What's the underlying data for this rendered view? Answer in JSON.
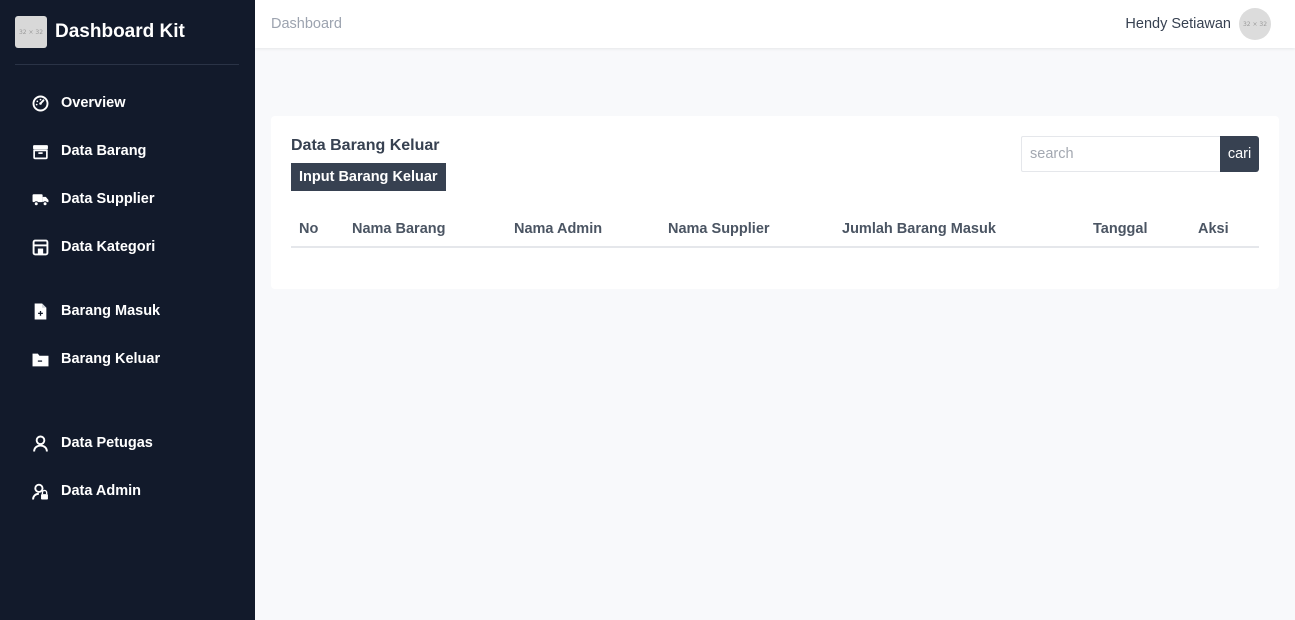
{
  "brand": {
    "logo_text": "32 × 32",
    "name": "Dashboard Kit"
  },
  "sidebar": {
    "items": [
      {
        "label": "Overview",
        "icon": "gauge-icon"
      },
      {
        "label": "Data Barang",
        "icon": "archive-box-icon"
      },
      {
        "label": "Data Supplier",
        "icon": "truck-icon"
      },
      {
        "label": "Data Kategori",
        "icon": "store-icon"
      },
      {
        "label": "Barang Masuk",
        "icon": "file-plus-icon"
      },
      {
        "label": "Barang Keluar",
        "icon": "folder-minus-icon"
      },
      {
        "label": "Data Petugas",
        "icon": "user-icon"
      },
      {
        "label": "Data Admin",
        "icon": "user-lock-icon"
      }
    ]
  },
  "header": {
    "breadcrumb": "Dashboard",
    "user_name": "Hendy Setiawan",
    "avatar_text": "32 × 32"
  },
  "main": {
    "title": "Data Barang Keluar",
    "input_button": "Input Barang Keluar",
    "search": {
      "placeholder": "search",
      "value": "",
      "button": "cari"
    },
    "table": {
      "columns": [
        "No",
        "Nama Barang",
        "Nama Admin",
        "Nama Supplier",
        "Jumlah Barang Masuk",
        "Tanggal",
        "Aksi"
      ],
      "rows": []
    }
  },
  "colors": {
    "sidebar_bg": "#121a2b",
    "accent": "#374151",
    "page_bg": "#f8f9fb"
  }
}
